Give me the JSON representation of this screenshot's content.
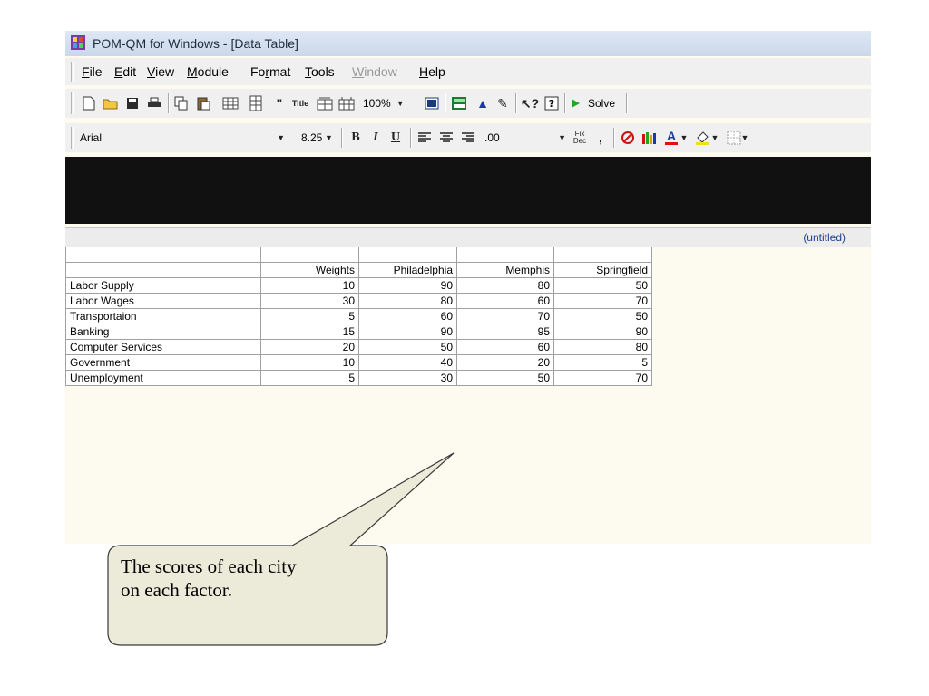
{
  "window": {
    "title": "POM-QM for Windows - [Data Table]"
  },
  "menu": [
    {
      "label": "File",
      "underline": "F",
      "enabled": true
    },
    {
      "label": "Edit",
      "underline": "E",
      "enabled": true
    },
    {
      "label": "View",
      "underline": "V",
      "enabled": true
    },
    {
      "label": "Module",
      "underline": "M",
      "enabled": true
    },
    {
      "label": "Format",
      "underline": "r",
      "enabled": true
    },
    {
      "label": "Tools",
      "underline": "T",
      "enabled": true
    },
    {
      "label": "Window",
      "underline": "W",
      "enabled": false
    },
    {
      "label": "Help",
      "underline": "H",
      "enabled": true
    }
  ],
  "toolbar1": {
    "title_button_label": "Title",
    "zoom_value": "100%",
    "solve_label": "Solve"
  },
  "toolbar2": {
    "font_name": "Arial",
    "font_size": "8.25",
    "bold_label": "B",
    "italic_label": "I",
    "underline_label": "U",
    "decimal_format": ".00",
    "fix_dec_label_top": "Fix",
    "fix_dec_label_bottom": "Dec",
    "comma_label": ",",
    "colors": {
      "font_color": "#e01010",
      "fill_color": "#f0e020"
    }
  },
  "status": {
    "file_name": "(untitled)"
  },
  "table": {
    "columns": [
      "",
      "Weights",
      "Philadelphia",
      "Memphis",
      "Springfield"
    ],
    "rows": [
      {
        "label": "Labor Supply",
        "values": [
          "10",
          "90",
          "80",
          "50"
        ]
      },
      {
        "label": "Labor Wages",
        "values": [
          "30",
          "80",
          "60",
          "70"
        ]
      },
      {
        "label": "Transportaion",
        "values": [
          "5",
          "60",
          "70",
          "50"
        ]
      },
      {
        "label": "Banking",
        "values": [
          "15",
          "90",
          "95",
          "90"
        ]
      },
      {
        "label": "Computer Services",
        "values": [
          "20",
          "50",
          "60",
          "80"
        ]
      },
      {
        "label": "Government",
        "values": [
          "10",
          "40",
          "20",
          "5"
        ]
      },
      {
        "label": "Unemployment",
        "values": [
          "5",
          "30",
          "50",
          "70"
        ]
      }
    ]
  },
  "callout": {
    "line1": "The scores of each city",
    "line2": "on each factor."
  }
}
